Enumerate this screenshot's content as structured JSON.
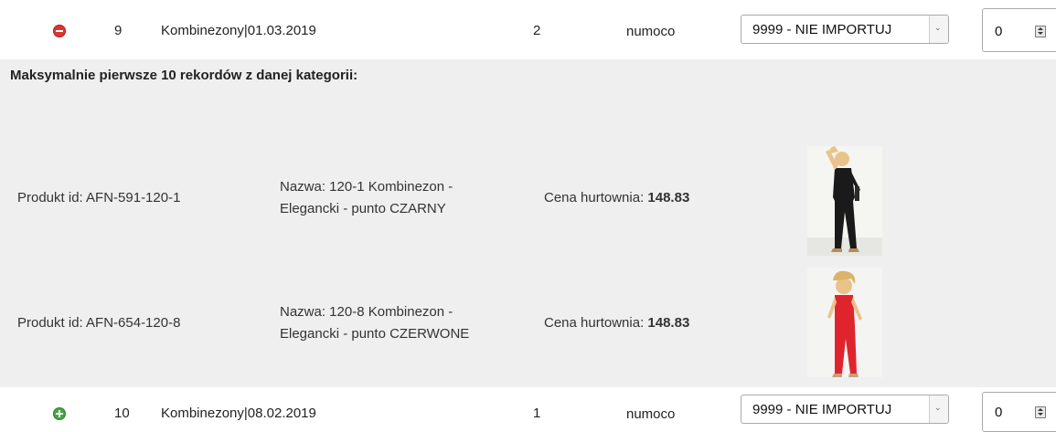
{
  "rows": [
    {
      "toggle_icon": "minus-circle-icon",
      "number": "9",
      "category": "Kombinezony|01.03.2019",
      "count": "2",
      "source": "numoco",
      "select_value": "9999 - NIE IMPORTUJ",
      "quantity": "0"
    },
    {
      "toggle_icon": "plus-circle-icon",
      "number": "10",
      "category": "Kombinezony|08.02.2019",
      "count": "1",
      "source": "numoco",
      "select_value": "9999 - NIE IMPORTUJ",
      "quantity": "0"
    }
  ],
  "details": {
    "title": "Maksymalnie pierwsze 10 rekordów z danej kategorii:",
    "products": [
      {
        "id_label": "Produkt id: AFN-591-120-1",
        "name_line1": "Nazwa: 120-1 Kombinezon -",
        "name_line2": "Elegancki - punto CZARNY",
        "price_label": "Cena hurtownia: ",
        "price_value": "148.83",
        "image_color": "#1a1a1a"
      },
      {
        "id_label": "Produkt id: AFN-654-120-8",
        "name_line1": "Nazwa: 120-8 Kombinezon -",
        "name_line2": "Elegancki - punto CZERWONE",
        "price_label": "Cena hurtownia: ",
        "price_value": "148.83",
        "image_color": "#e0242d"
      }
    ]
  },
  "colors": {
    "remove": "#d9362f",
    "add": "#46a544",
    "detail_bg": "#efefef"
  }
}
